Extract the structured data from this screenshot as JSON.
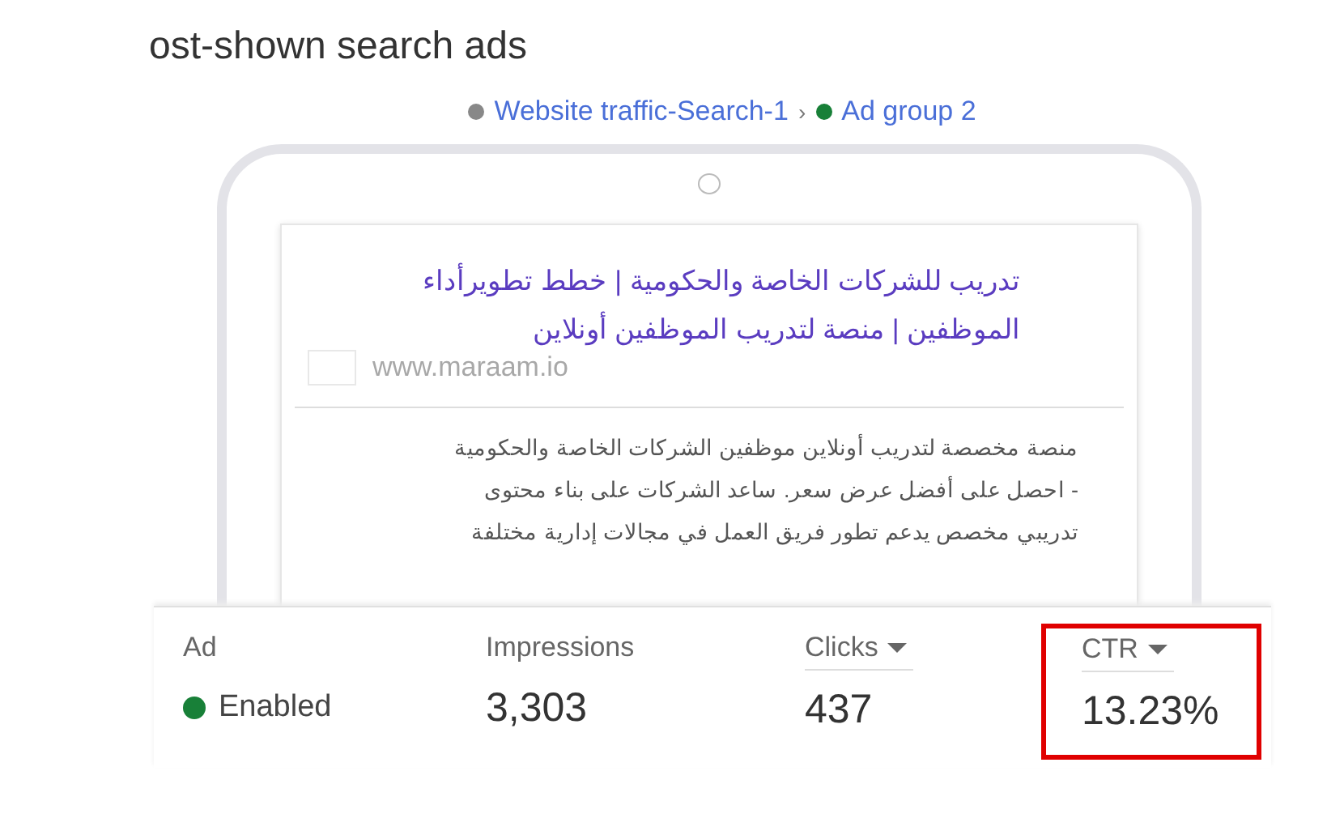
{
  "title": "ost-shown search ads",
  "breadcrumb": {
    "campaign": {
      "label": "Website traffic-Search-1",
      "color": "#888888"
    },
    "separator": "›",
    "ad_group": {
      "label": "Ad group 2",
      "color": "#188038"
    }
  },
  "ad": {
    "headline": "تدريب للشركات الخاصة والحكومية | خطط تطويرأداء الموظفين | منصة لتدريب الموظفين أونلاين",
    "url": "www.maraam.io",
    "description": [
      "منصة مخصصة لتدريب أونلاين موظفين الشركات الخاصة والحكومية",
      "- احصل على أفضل عرض سعر. ساعد الشركات على بناء محتوى",
      "تدريبي مخصص يدعم تطور فريق العمل في مجالات إدارية مختلفة"
    ]
  },
  "stats": {
    "ad": {
      "label": "Ad",
      "sortable": false,
      "highlighted": false,
      "status": {
        "label": "Enabled",
        "color": "#188038"
      }
    },
    "impressions": {
      "label": "Impressions",
      "sortable": false,
      "highlighted": false,
      "value": "3,303"
    },
    "clicks": {
      "label": "Clicks",
      "sortable": true,
      "highlighted": false,
      "value": "437"
    },
    "ctr": {
      "label": "CTR",
      "sortable": true,
      "highlighted": true,
      "value": "13.23%"
    }
  }
}
